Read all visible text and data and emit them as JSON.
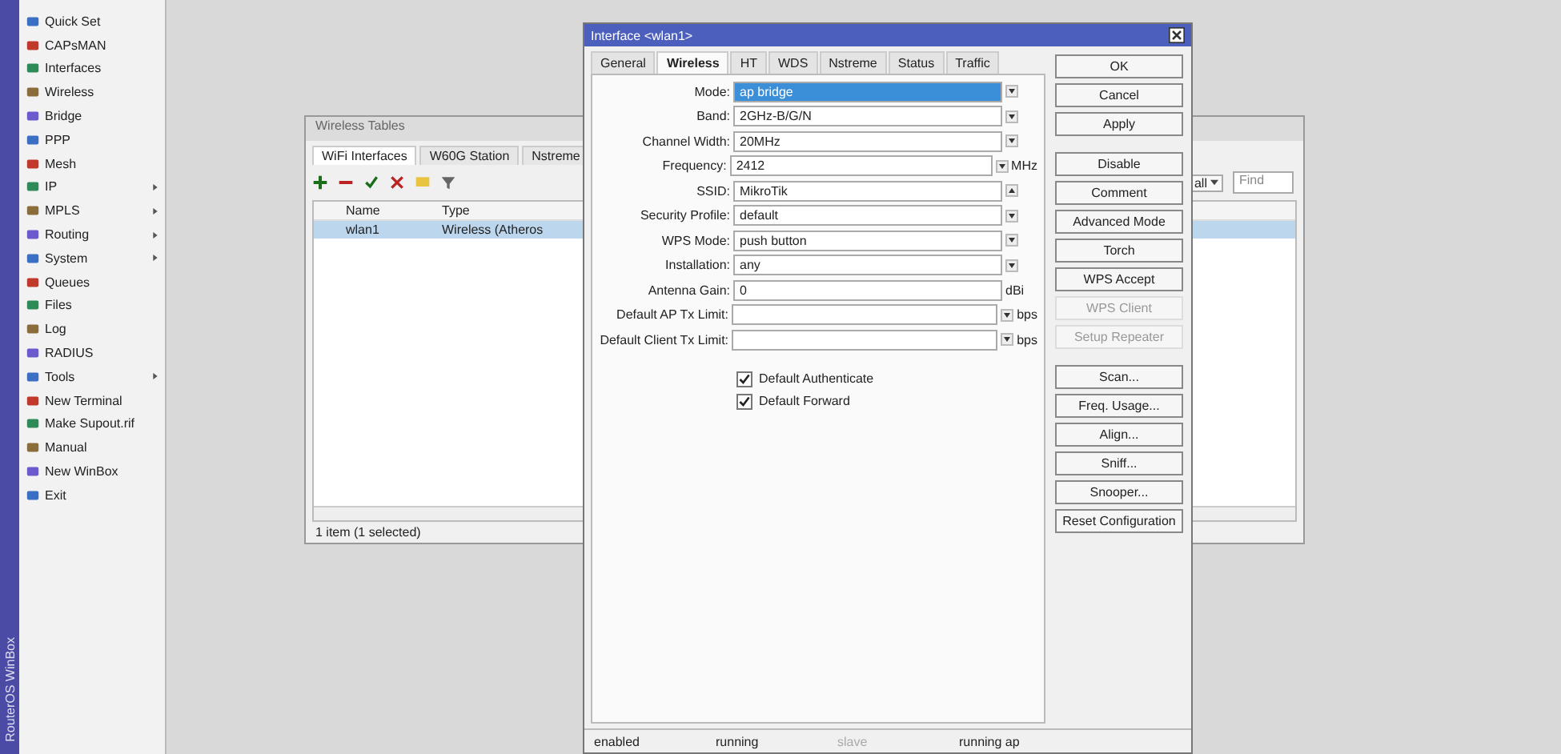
{
  "sidebar": {
    "vertical_title": "RouterOS WinBox",
    "items": [
      {
        "label": "Quick Set",
        "submenu": false
      },
      {
        "label": "CAPsMAN",
        "submenu": false
      },
      {
        "label": "Interfaces",
        "submenu": false
      },
      {
        "label": "Wireless",
        "submenu": false
      },
      {
        "label": "Bridge",
        "submenu": false
      },
      {
        "label": "PPP",
        "submenu": false
      },
      {
        "label": "Mesh",
        "submenu": false
      },
      {
        "label": "IP",
        "submenu": true
      },
      {
        "label": "MPLS",
        "submenu": true
      },
      {
        "label": "Routing",
        "submenu": true
      },
      {
        "label": "System",
        "submenu": true
      },
      {
        "label": "Queues",
        "submenu": false
      },
      {
        "label": "Files",
        "submenu": false
      },
      {
        "label": "Log",
        "submenu": false
      },
      {
        "label": "RADIUS",
        "submenu": false
      },
      {
        "label": "Tools",
        "submenu": true
      },
      {
        "label": "New Terminal",
        "submenu": false
      },
      {
        "label": "Make Supout.rif",
        "submenu": false
      },
      {
        "label": "Manual",
        "submenu": false
      },
      {
        "label": "New WinBox",
        "submenu": false
      },
      {
        "label": "Exit",
        "submenu": false
      }
    ]
  },
  "tables_window": {
    "title": "Wireless Tables",
    "tabs": [
      {
        "label": "WiFi Interfaces",
        "selected": true
      },
      {
        "label": "W60G Station",
        "selected": false
      },
      {
        "label": "Nstreme",
        "selected": false
      }
    ],
    "find_placeholder": "Find",
    "filter": "all",
    "columns": [
      "Name",
      "Type"
    ],
    "rows": [
      {
        "name": "wlan1",
        "type": "Wireless (Atheros",
        "selected": true
      }
    ],
    "status": "1 item (1 selected)"
  },
  "dialog": {
    "title": "Interface <wlan1>",
    "tabs": [
      {
        "label": "General",
        "selected": false
      },
      {
        "label": "Wireless",
        "selected": true
      },
      {
        "label": "HT",
        "selected": false
      },
      {
        "label": "WDS",
        "selected": false
      },
      {
        "label": "Nstreme",
        "selected": false
      },
      {
        "label": "Status",
        "selected": false
      },
      {
        "label": "Traffic",
        "selected": false
      }
    ],
    "fields": [
      {
        "label": "Mode:",
        "value": "ap bridge",
        "kind": "dropdown",
        "focused": true
      },
      {
        "label": "Band:",
        "value": "2GHz-B/G/N",
        "kind": "dropdown",
        "focused": false
      },
      {
        "label": "Channel Width:",
        "value": "20MHz",
        "kind": "dropdown",
        "focused": false
      },
      {
        "label": "Frequency:",
        "value": "2412",
        "kind": "dropdown",
        "unit": "MHz",
        "focused": false
      },
      {
        "label": "SSID:",
        "value": "MikroTik",
        "kind": "collapse",
        "focused": false
      },
      {
        "label": "Security Profile:",
        "value": "default",
        "kind": "dropdown",
        "focused": false
      },
      {
        "label": "WPS Mode:",
        "value": "push button",
        "kind": "dropdown",
        "focused": false
      },
      {
        "label": "Installation:",
        "value": "any",
        "kind": "dropdown",
        "focused": false
      },
      {
        "label": "Antenna Gain:",
        "value": "0",
        "kind": "plain",
        "unit": "dBi",
        "focused": false
      },
      {
        "label": "Default AP Tx Limit:",
        "kind": "dropdown",
        "unit": "bps",
        "focused": false
      },
      {
        "label": "Default Client Tx Limit:",
        "kind": "dropdown",
        "unit": "bps",
        "focused": false
      }
    ],
    "checkboxes": [
      {
        "label": "Default Authenticate",
        "checked": true
      },
      {
        "label": "Default Forward",
        "checked": true
      }
    ],
    "button_groups": [
      [
        {
          "label": "OK",
          "disabled": false
        },
        {
          "label": "Cancel",
          "disabled": false
        },
        {
          "label": "Apply",
          "disabled": false
        }
      ],
      [
        {
          "label": "Disable",
          "disabled": false
        },
        {
          "label": "Comment",
          "disabled": false
        },
        {
          "label": "Advanced Mode",
          "disabled": false
        },
        {
          "label": "Torch",
          "disabled": false
        },
        {
          "label": "WPS Accept",
          "disabled": false
        },
        {
          "label": "WPS Client",
          "disabled": true
        },
        {
          "label": "Setup Repeater",
          "disabled": true
        }
      ],
      [
        {
          "label": "Scan...",
          "disabled": false
        },
        {
          "label": "Freq. Usage...",
          "disabled": false
        },
        {
          "label": "Align...",
          "disabled": false
        },
        {
          "label": "Sniff...",
          "disabled": false
        },
        {
          "label": "Snooper...",
          "disabled": false
        },
        {
          "label": "Reset Configuration",
          "disabled": false
        }
      ]
    ],
    "status": [
      {
        "label": "enabled",
        "disabled": false
      },
      {
        "label": "running",
        "disabled": false
      },
      {
        "label": "slave",
        "disabled": true
      },
      {
        "label": "running ap",
        "disabled": false
      }
    ]
  }
}
